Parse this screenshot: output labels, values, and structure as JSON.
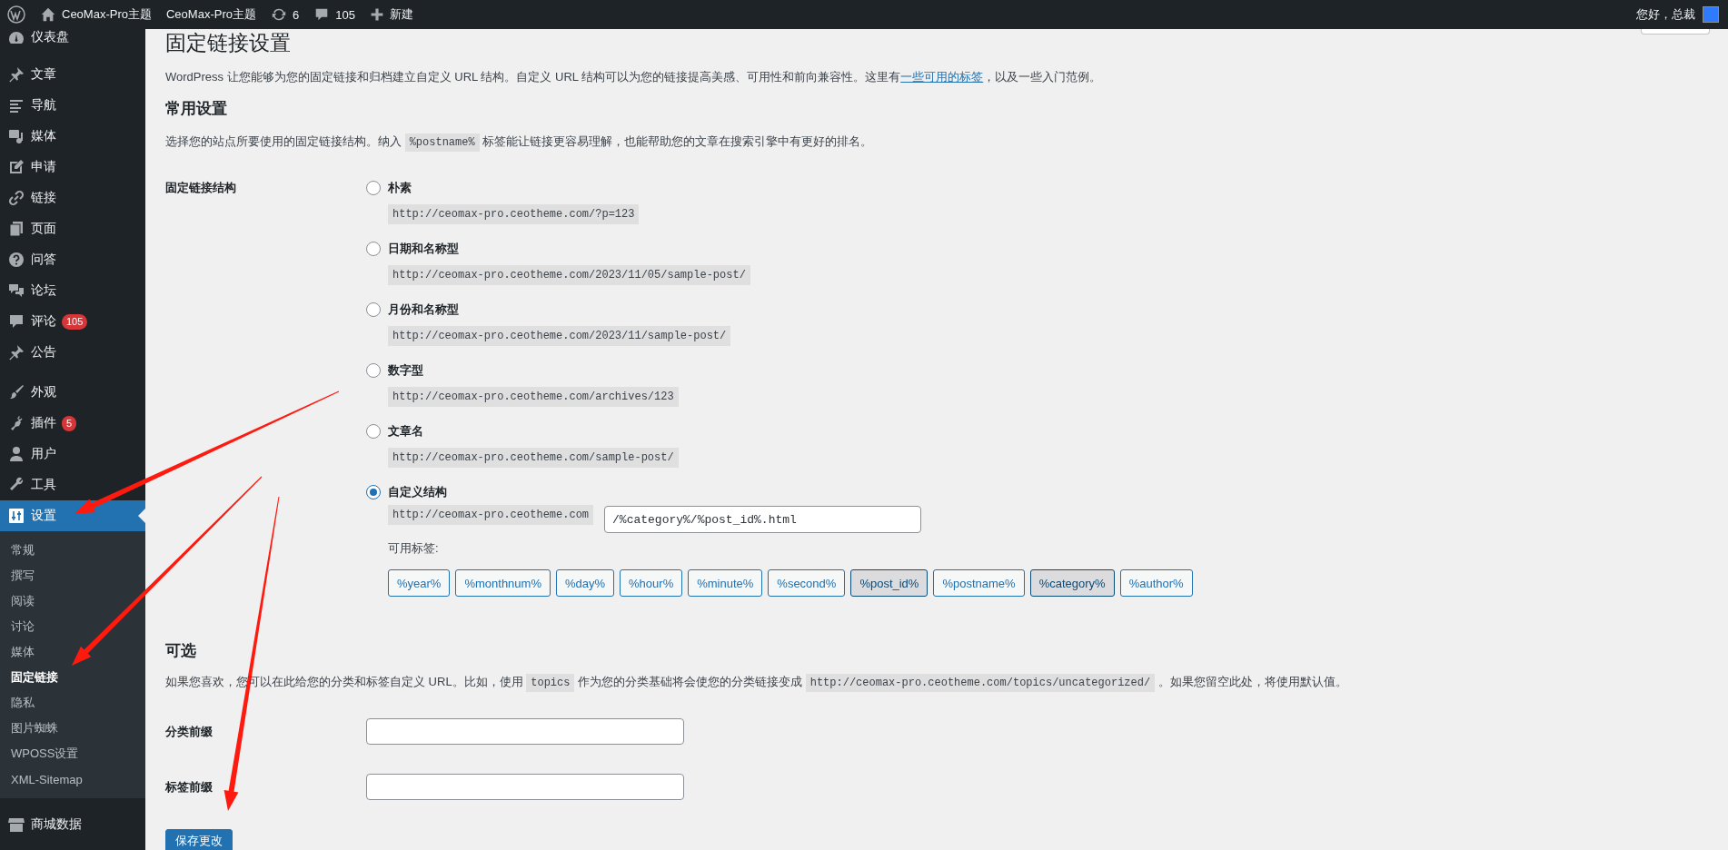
{
  "admin_bar": {
    "items": [
      {
        "kind": "logo"
      },
      {
        "kind": "home",
        "label": "CeoMax-Pro主题"
      },
      {
        "kind": "text",
        "label": "CeoMax-Pro主题"
      },
      {
        "kind": "updates",
        "label": "6"
      },
      {
        "kind": "comments",
        "label": "105"
      },
      {
        "kind": "new",
        "label": "新建"
      }
    ],
    "greeting": "您好，总裁"
  },
  "sidebar": {
    "items": [
      {
        "kind": "item",
        "label": "仪表盘",
        "selected": false
      },
      {
        "kind": "separator"
      },
      {
        "kind": "item",
        "label": "文章",
        "selected": false
      },
      {
        "kind": "item",
        "label": "导航",
        "selected": false
      },
      {
        "kind": "item",
        "label": "媒体",
        "selected": false
      },
      {
        "kind": "item",
        "label": "申请",
        "selected": false
      },
      {
        "kind": "item",
        "label": "链接",
        "selected": false
      },
      {
        "kind": "item",
        "label": "页面",
        "selected": false
      },
      {
        "kind": "item",
        "label": "问答",
        "selected": false
      },
      {
        "kind": "item",
        "label": "论坛",
        "selected": false
      },
      {
        "kind": "item",
        "label": "评论",
        "badge": "105",
        "selected": false
      },
      {
        "kind": "item",
        "label": "公告",
        "selected": false
      },
      {
        "kind": "separator"
      },
      {
        "kind": "item",
        "label": "外观",
        "selected": false
      },
      {
        "kind": "item",
        "label": "插件",
        "badge": "5",
        "selected": false
      },
      {
        "kind": "item",
        "label": "用户",
        "selected": false
      },
      {
        "kind": "item",
        "label": "工具",
        "selected": false
      },
      {
        "kind": "item",
        "label": "设置",
        "selected": true,
        "children": [
          {
            "label": "常规",
            "selected": false
          },
          {
            "label": "撰写",
            "selected": false
          },
          {
            "label": "阅读",
            "selected": false
          },
          {
            "label": "讨论",
            "selected": false
          },
          {
            "label": "媒体",
            "selected": false
          },
          {
            "label": "固定链接",
            "selected": true
          },
          {
            "label": "隐私",
            "selected": false
          },
          {
            "label": "图片蜘蛛",
            "selected": false
          },
          {
            "label": "WPOSS设置",
            "selected": false
          },
          {
            "label": "XML-Sitemap",
            "selected": false
          }
        ]
      },
      {
        "kind": "separator"
      },
      {
        "kind": "item",
        "label": "商城数据",
        "selected": false
      }
    ]
  },
  "page": {
    "title": "固定链接设置",
    "intro": [
      {
        "kind": "text",
        "text": "WordPress 让您能够为您的固定链接和归档建立自定义 URL 结构。自定义 URL 结构可以为您的链接提高美感、可用性和前向兼容性。这里有"
      },
      {
        "kind": "link",
        "text": "一些可用的标签"
      },
      {
        "kind": "text",
        "text": "，以及一些入门范例。"
      }
    ],
    "common": {
      "heading": "常用设置",
      "description": [
        {
          "kind": "text",
          "text": "选择您的站点所要使用的固定链接结构。纳入 "
        },
        {
          "kind": "code",
          "text": "%postname%"
        },
        {
          "kind": "text",
          "text": " 标签能让链接更容易理解，也能帮助您的文章在搜索引擎中有更好的排名。"
        }
      ],
      "label": "固定链接结构",
      "options": [
        {
          "label": "朴素",
          "example": "http://ceomax-pro.ceotheme.com/?p=123",
          "selected": false
        },
        {
          "label": "日期和名称型",
          "example": "http://ceomax-pro.ceotheme.com/2023/11/05/sample-post/",
          "selected": false
        },
        {
          "label": "月份和名称型",
          "example": "http://ceomax-pro.ceotheme.com/2023/11/sample-post/",
          "selected": false
        },
        {
          "label": "数字型",
          "example": "http://ceomax-pro.ceotheme.com/archives/123",
          "selected": false
        },
        {
          "label": "文章名",
          "example": "http://ceomax-pro.ceotheme.com/sample-post/",
          "selected": false
        }
      ],
      "custom": {
        "label": "自定义结构",
        "prefix": "http://ceomax-pro.ceotheme.com",
        "value": "/%category%/%post_id%.html",
        "selected": true,
        "tags_label": "可用标签:",
        "tags": [
          {
            "label": "%year%",
            "pressed": false
          },
          {
            "label": "%monthnum%",
            "pressed": false
          },
          {
            "label": "%day%",
            "pressed": false
          },
          {
            "label": "%hour%",
            "pressed": false
          },
          {
            "label": "%minute%",
            "pressed": false
          },
          {
            "label": "%second%",
            "pressed": false
          },
          {
            "label": "%post_id%",
            "pressed": true
          },
          {
            "label": "%postname%",
            "pressed": false
          },
          {
            "label": "%category%",
            "pressed": true
          },
          {
            "label": "%author%",
            "pressed": false
          }
        ]
      }
    },
    "optional": {
      "heading": "可选",
      "description": [
        {
          "kind": "text",
          "text": "如果您喜欢，您可以在此给您的分类和标签自定义 URL。比如，使用 "
        },
        {
          "kind": "code",
          "text": "topics"
        },
        {
          "kind": "text",
          "text": " 作为您的分类基础将会使您的分类链接变成 "
        },
        {
          "kind": "code",
          "text": "http://ceomax-pro.ceotheme.com/topics/uncategorized/"
        },
        {
          "kind": "text",
          "text": " 。如果您留空此处，将使用默认值。"
        }
      ],
      "fields": [
        {
          "label": "分类前缀"
        },
        {
          "label": "标签前缀"
        }
      ]
    },
    "save_button": "保存更改"
  },
  "annotations": [
    {
      "kind": "arrow"
    },
    {
      "kind": "arrow"
    },
    {
      "kind": "arrow"
    }
  ]
}
